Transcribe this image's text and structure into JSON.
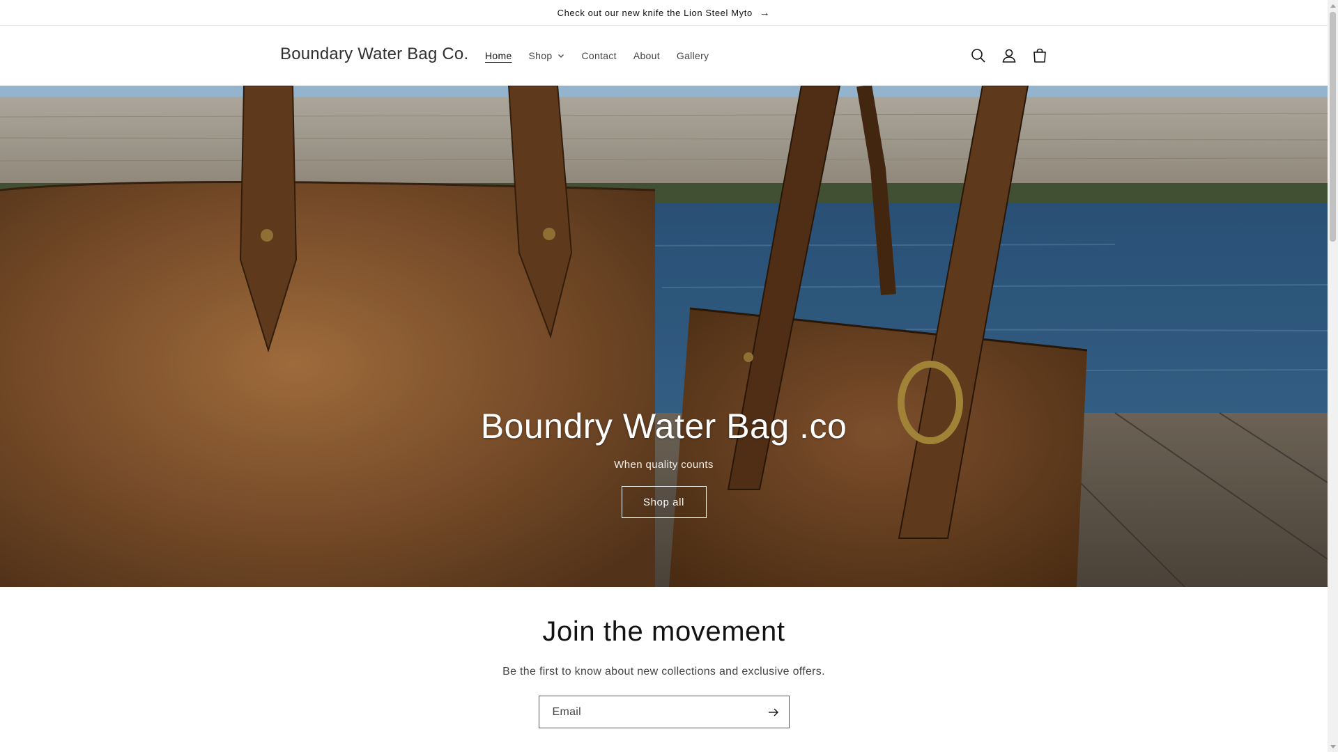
{
  "announcement": {
    "text": "Check out our new knife the Lion Steel Myto",
    "arrow": "→"
  },
  "header": {
    "logo": "Boundary Water Bag Co.",
    "nav": [
      {
        "label": "Home",
        "active": true
      },
      {
        "label": "Shop",
        "dropdown": true
      },
      {
        "label": "Contact"
      },
      {
        "label": "About"
      },
      {
        "label": "Gallery"
      }
    ],
    "icons": [
      "search-icon",
      "account-icon",
      "cart-icon"
    ]
  },
  "hero": {
    "title": "Boundry Water Bag .co",
    "subtitle": "When quality counts",
    "button": "Shop all"
  },
  "newsletter": {
    "heading": "Join the movement",
    "text": "Be the first to know about new collections and exclusive offers.",
    "email_placeholder": "Email"
  },
  "colors": {
    "text": "#121212",
    "leather_light": "#a9713f",
    "leather_dark": "#5a3519",
    "water": "#2e5c8a"
  }
}
